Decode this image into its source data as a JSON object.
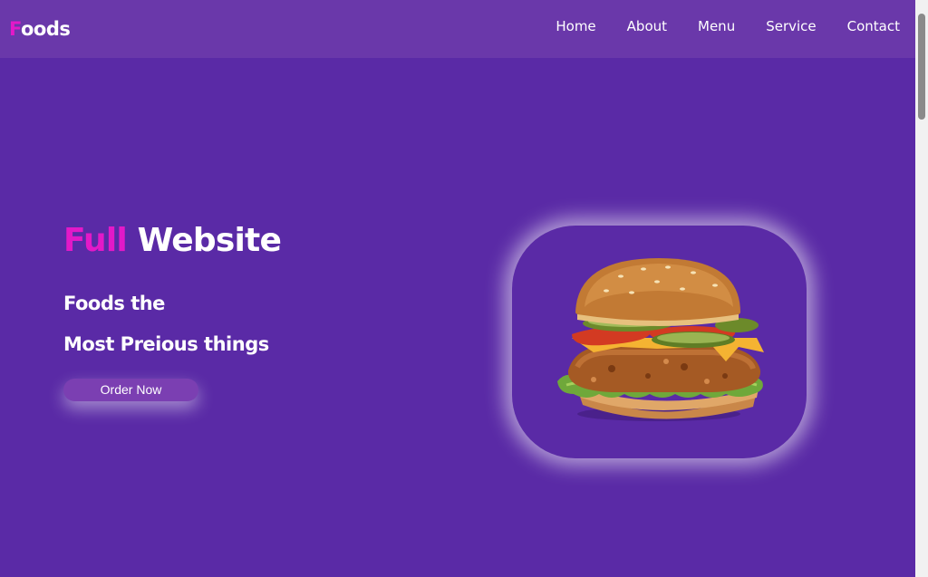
{
  "brand": {
    "logo_accent": "F",
    "logo_rest": "oods"
  },
  "nav": {
    "items": [
      "Home",
      "About",
      "Menu",
      "Service",
      "Contact"
    ]
  },
  "hero": {
    "title_accent": "Full",
    "title_rest": " Website",
    "subtitle_line1": "Foods the",
    "subtitle_line2": "Most Preious things",
    "button_label": "Order Now"
  },
  "colors": {
    "background": "#5a2aa6",
    "navbar": "#6a38aa",
    "accent": "#e319c8",
    "text": "#ffffff"
  },
  "icons": {
    "hero_image": "burger-image"
  }
}
